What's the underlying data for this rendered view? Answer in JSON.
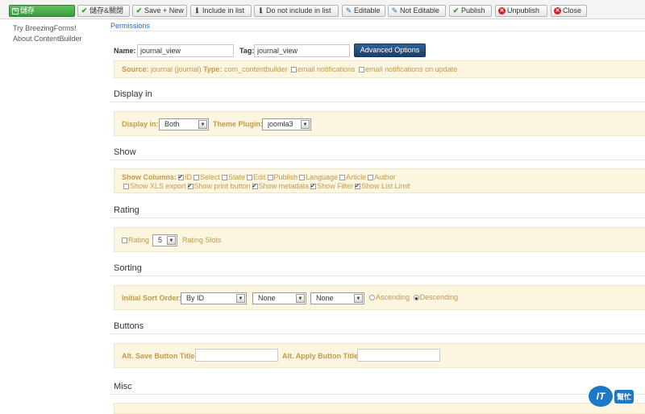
{
  "toolbar": {
    "save": "儲存",
    "save_close": "儲存&關閉",
    "save_new": "Save + New",
    "include_in_list": "Include in list",
    "not_include_in_list": "Do not include in list",
    "editable": "Editable",
    "not_editable": "Not Editable",
    "publish": "Publish",
    "unpublish": "Unpublish",
    "close": "Close"
  },
  "sidebar": {
    "items": [
      {
        "label": "Try BreezingForms!"
      },
      {
        "label": "About ContentBuilder"
      }
    ]
  },
  "tabs": {
    "permissions": "Permissions"
  },
  "form": {
    "name_label": "Name:",
    "name_value": "journal_view",
    "tag_label": "Tag:",
    "tag_value": "journal_view",
    "advanced_options": "Advanced Options",
    "source_label": "Source:",
    "source_value": "journal (journal)",
    "type_label": "Type:",
    "type_value": "com_contentbuilder",
    "email_notifications": "email notifications",
    "email_notifications_update": "email notifications on update"
  },
  "display_in": {
    "title": "Display in",
    "display_in_label": "Display in:",
    "display_in_value": "Both",
    "theme_plugin_label": "Theme Plugin:",
    "theme_plugin_value": "joomla3"
  },
  "show": {
    "title": "Show",
    "columns_label": "Show Columns:",
    "columns": [
      {
        "label": "ID",
        "checked": true
      },
      {
        "label": "Select",
        "checked": false
      },
      {
        "label": "State",
        "checked": false
      },
      {
        "label": "Edit",
        "checked": false
      },
      {
        "label": "Publish",
        "checked": false
      },
      {
        "label": "Language",
        "checked": false
      },
      {
        "label": "Article",
        "checked": false
      },
      {
        "label": "Author",
        "checked": false
      }
    ],
    "row2": [
      {
        "label": "Show XLS export",
        "checked": false
      },
      {
        "label": "Show print button",
        "checked": true
      },
      {
        "label": "Show metadata",
        "checked": true
      },
      {
        "label": "Show Filter",
        "checked": true
      },
      {
        "label": "Show List Limit",
        "checked": true
      }
    ]
  },
  "rating": {
    "title": "Rating",
    "rating_label": "Rating",
    "slots_value": "5",
    "slots_label": "Rating Slots"
  },
  "sorting": {
    "title": "Sorting",
    "initial_sort_label": "Initial Sort Order:",
    "sort1": "By ID",
    "sort2": "None",
    "sort3": "None",
    "ascending": "Ascending",
    "descending": "Descending"
  },
  "buttons": {
    "title": "Buttons",
    "save_title_label": "Alt. Save Button Title:",
    "apply_title_label": "Alt. Apply Button Title:"
  },
  "misc": {
    "title": "Misc"
  },
  "badge": {
    "logo": "IT",
    "text": "幫忙"
  }
}
